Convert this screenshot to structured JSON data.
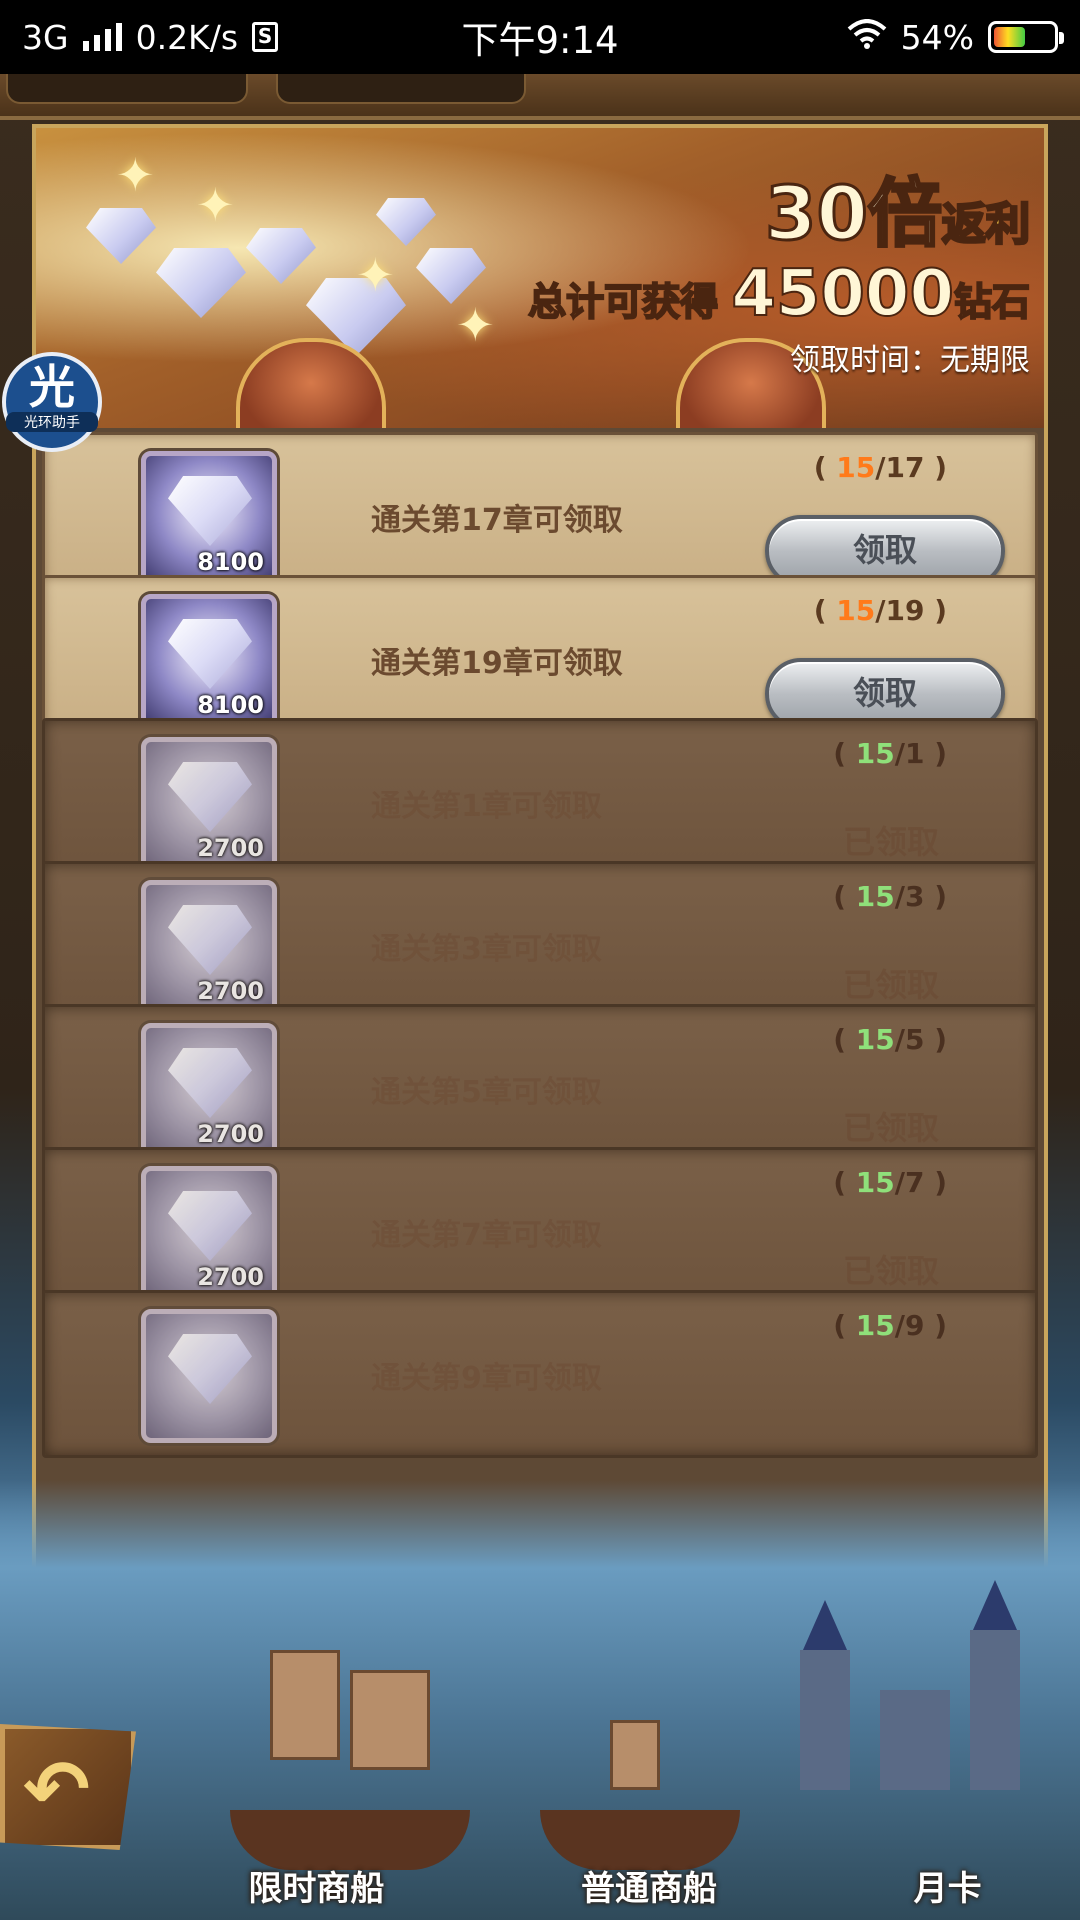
{
  "status_bar": {
    "network": "3G",
    "speed": "0.2K/s",
    "time": "下午9:14",
    "battery_percent": "54%",
    "battery_level": 0.54
  },
  "banner": {
    "multiplier": "30倍",
    "rebate": "返利",
    "total_prefix": "总计可获得",
    "total_amount": "45000",
    "total_suffix": "钻石",
    "claim_period": "领取时间：无期限"
  },
  "assistant": {
    "glyph": "光",
    "caption": "光环助手"
  },
  "rewards": [
    {
      "amount": "8100",
      "label": "通关第17章可领取",
      "current": "15",
      "target": "/17",
      "status": "claimable",
      "action": "领取"
    },
    {
      "amount": "8100",
      "label": "通关第19章可领取",
      "current": "15",
      "target": "/19",
      "status": "claimable",
      "action": "领取"
    },
    {
      "amount": "2700",
      "label": "通关第1章可领取",
      "current": "15",
      "target": "/1",
      "status": "claimed",
      "action": "已领取"
    },
    {
      "amount": "2700",
      "label": "通关第3章可领取",
      "current": "15",
      "target": "/3",
      "status": "claimed",
      "action": "已领取"
    },
    {
      "amount": "2700",
      "label": "通关第5章可领取",
      "current": "15",
      "target": "/5",
      "status": "claimed",
      "action": "已领取"
    },
    {
      "amount": "2700",
      "label": "通关第7章可领取",
      "current": "15",
      "target": "/7",
      "status": "claimed",
      "action": "已领取"
    },
    {
      "amount": "",
      "label": "通关第9章可领取",
      "current": "15",
      "target": "/9",
      "status": "claimed",
      "action": ""
    }
  ],
  "progress_paren_open": "( ",
  "progress_paren_close": " )",
  "bottom_nav": {
    "limited_ship": "限时商船",
    "normal_ship": "普通商船",
    "monthly_card": "月卡"
  },
  "colors": {
    "progress_current_claimable": "#ff7a1a",
    "progress_current_claimed": "#8fe07a",
    "panel_border": "#c8a55c"
  }
}
